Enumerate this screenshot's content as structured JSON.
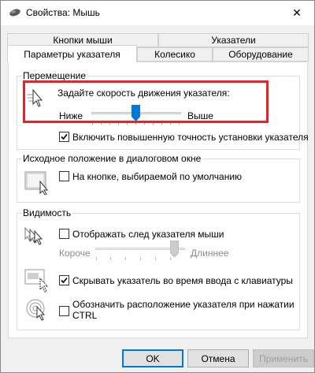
{
  "window": {
    "title": "Свойства: Мышь",
    "close_glyph": "✕"
  },
  "tabs": {
    "row1": [
      {
        "label": "Кнопки мыши"
      },
      {
        "label": "Указатели"
      }
    ],
    "row2": [
      {
        "label": "Параметры указателя",
        "active": true
      },
      {
        "label": "Колесико"
      },
      {
        "label": "Оборудование"
      }
    ]
  },
  "motion": {
    "group_title": "Перемещение",
    "speed_prompt": "Задайте скорость движения указателя:",
    "slow_label": "Ниже",
    "fast_label": "Выше",
    "speed_level": 0.5,
    "precision_label": "Включить повышенную точность установки указателя",
    "precision_checked": true
  },
  "snap": {
    "group_title": "Исходное положение в диалоговом окне",
    "snap_label": "На кнопке, выбираемой по умолчанию",
    "snap_checked": false
  },
  "visibility": {
    "group_title": "Видимость",
    "trails_label": "Отображать след указателя мыши",
    "trails_checked": false,
    "short_label": "Короче",
    "long_label": "Длиннее",
    "trail_level": 1.0,
    "hide_label": "Скрывать указатель во время ввода с клавиатуры",
    "hide_checked": true,
    "ctrl_label_line1": "Обозначить расположение указателя при нажатии",
    "ctrl_label_line2": "CTRL",
    "ctrl_checked": false
  },
  "buttons": {
    "ok": "OK",
    "cancel": "Отмена",
    "apply": "Применить"
  },
  "colors": {
    "highlight": "#e3242b",
    "thumb_active": "#0078d7",
    "accent": "#0078d7"
  }
}
